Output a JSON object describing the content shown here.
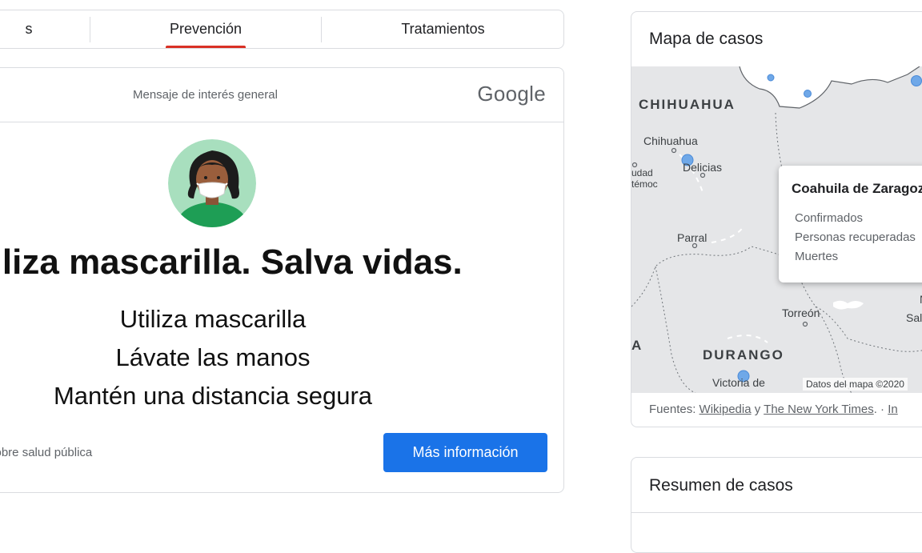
{
  "tabs": {
    "items": [
      {
        "label": "s"
      },
      {
        "label": "Prevención"
      },
      {
        "label": "Tratamientos"
      }
    ],
    "active_color": "#d93025"
  },
  "ad": {
    "label": "Mensaje de interés general",
    "brand": "Google",
    "headline": "Utiliza mascarilla. Salva vidas.",
    "lines": [
      "Utiliza mascarilla",
      "Lávate las manos",
      "Mantén una distancia segura"
    ],
    "footer_text": "sobre salud pública",
    "button_label": "Más información",
    "button_color": "#1a73e8"
  },
  "map": {
    "title": "Mapa de casos",
    "states": [
      "CHIHUAHUA",
      "DURANGO",
      "A"
    ],
    "cities": [
      "Chihuahua",
      "Delicias",
      "udad",
      "témoc",
      "Parral",
      "Torreón",
      "Sal",
      "Victoria de",
      "N"
    ],
    "attribution": "Datos del mapa ©2020",
    "tooltip": {
      "title": "Coahuila de Zaragoza",
      "rows": [
        "Confirmados",
        "Personas recuperadas",
        "Muertes"
      ]
    },
    "sources_prefix": "Fuentes:",
    "source_1": "Wikipedia",
    "source_join": "y",
    "source_2": "The New York Times",
    "sources_suffix": ". ·",
    "source_more": "In"
  },
  "summary": {
    "title": "Resumen de casos"
  }
}
